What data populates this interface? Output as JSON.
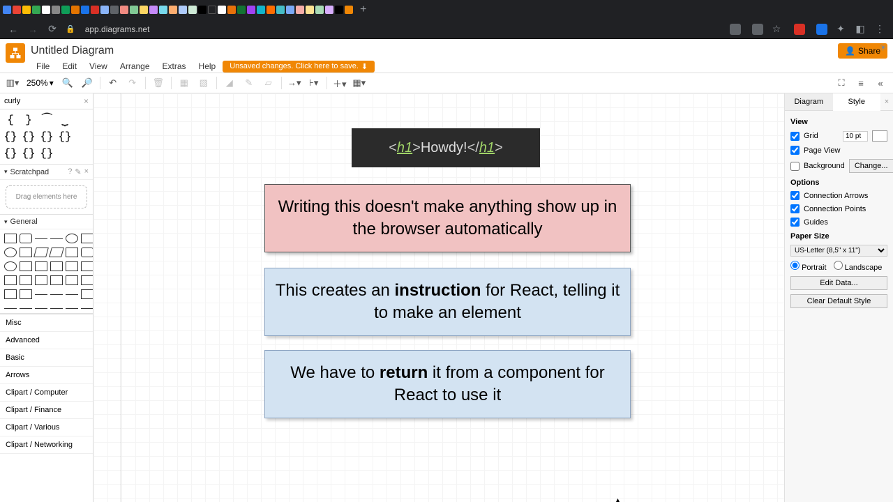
{
  "browser": {
    "url": "app.diagrams.net",
    "newtab": "+"
  },
  "app": {
    "doc_title": "Untitled Diagram",
    "menus": [
      "File",
      "Edit",
      "View",
      "Arrange",
      "Extras",
      "Help"
    ],
    "save_notice": "Unsaved changes. Click here to save.",
    "share_label": "Share"
  },
  "toolbar": {
    "zoom": "250%"
  },
  "left": {
    "search_value": "curly",
    "scratchpad_title": "Scratchpad",
    "drag_hint": "Drag elements here",
    "general_title": "General",
    "sections": [
      "Misc",
      "Advanced",
      "Basic",
      "Arrows",
      "Clipart / Computer",
      "Clipart / Finance",
      "Clipart / Various",
      "Clipart / Networking"
    ]
  },
  "canvas": {
    "code_tag": "h1",
    "code_text": "Howdy!",
    "box1": "Writing this doesn't make anything show up in the browser automatically",
    "box2_pre": "This creates an ",
    "box2_bold": "instruction",
    "box2_post": " for React, telling it to make an element",
    "box3_pre": "We have to ",
    "box3_bold": "return",
    "box3_post": " it from a component for React to use it"
  },
  "right": {
    "tabs": {
      "diagram": "Diagram",
      "style": "Style"
    },
    "view_title": "View",
    "grid_label": "Grid",
    "grid_value": "10 pt",
    "pageview_label": "Page View",
    "background_label": "Background",
    "change_btn": "Change...",
    "options_title": "Options",
    "conn_arrows": "Connection Arrows",
    "conn_points": "Connection Points",
    "guides": "Guides",
    "papersize_title": "Paper Size",
    "papersize_value": "US-Letter (8,5\" x 11\")",
    "portrait": "Portrait",
    "landscape": "Landscape",
    "edit_data": "Edit Data...",
    "clear_style": "Clear Default Style"
  }
}
